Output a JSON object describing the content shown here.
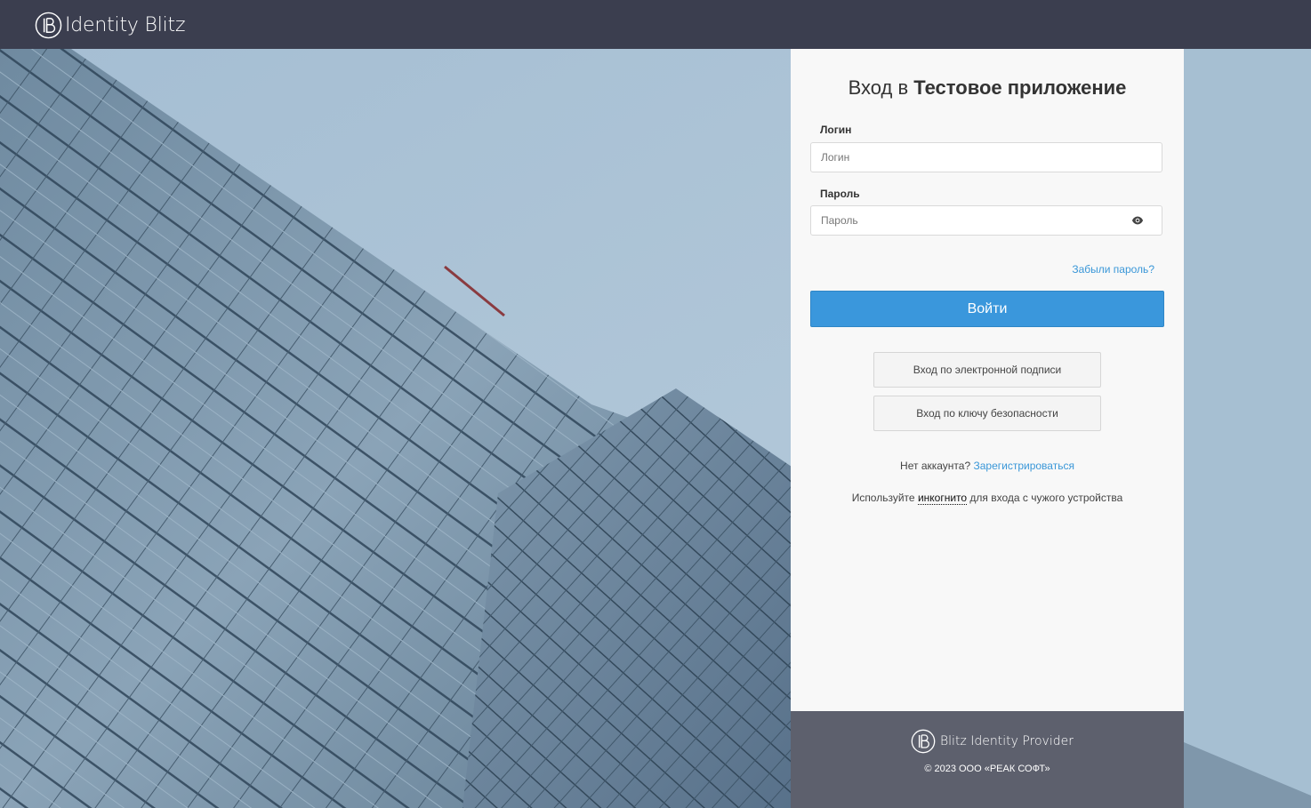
{
  "header": {
    "brand": "Identity Blitz"
  },
  "login": {
    "title_prefix": "Вход в",
    "title_app": "Тестовое приложение",
    "login_label": "Логин",
    "login_placeholder": "Логин",
    "login_value": "",
    "password_label": "Пароль",
    "password_placeholder": "Пароль",
    "password_value": "",
    "password_toggle_icon": "eye-icon",
    "forgot_link": "Забыли пароль?",
    "submit_label": "Войти",
    "esign_button": "Вход по электронной подписи",
    "security_key_button": "Вход по ключу безопасности",
    "no_account_text": "Нет аккаунта?",
    "register_link": "Зарегистрироваться",
    "incognito_prefix": "Используйте",
    "incognito_word": "инкогнито",
    "incognito_suffix": "для входа с чужого устройства"
  },
  "footer": {
    "brand": "Blitz Identity Provider",
    "copyright": "© 2023 ООО «РЕАК СОФТ»"
  },
  "colors": {
    "header_bg": "#3b3e4f",
    "primary": "#3a97dc",
    "link": "#3a97d8",
    "panel_bg": "#f8f8f8",
    "footer_bg": "#5d606d"
  }
}
